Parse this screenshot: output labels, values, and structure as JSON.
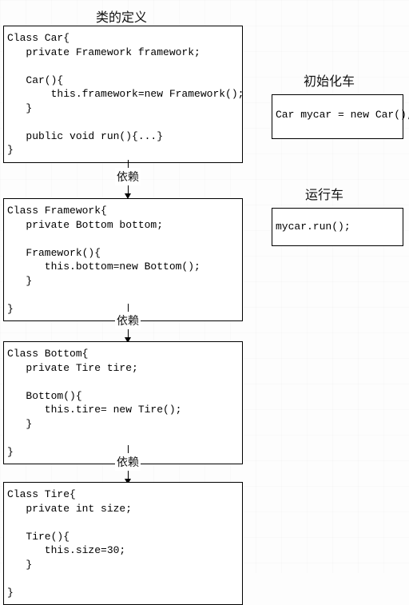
{
  "headings": {
    "classdef": "类的定义",
    "init": "初始化车",
    "run": "运行车"
  },
  "connectors": {
    "dep": "依赖"
  },
  "boxes": {
    "car": "Class Car{\n   private Framework framework;\n\n   Car(){\n       this.framework=new Framework();\n   }\n\n   public void run(){...}\n}",
    "framework": "Class Framework{\n   private Bottom bottom;\n\n   Framework(){\n      this.bottom=new Bottom();\n   }\n\n}",
    "bottom": "Class Bottom{\n   private Tire tire;\n\n   Bottom(){\n      this.tire= new Tire();\n   }\n\n}",
    "tire": "Class Tire{\n   private int size;\n\n   Tire(){\n      this.size=30;\n   }\n\n}",
    "initcar": "Car mycar = new Car();",
    "runcar": "mycar.run();"
  }
}
